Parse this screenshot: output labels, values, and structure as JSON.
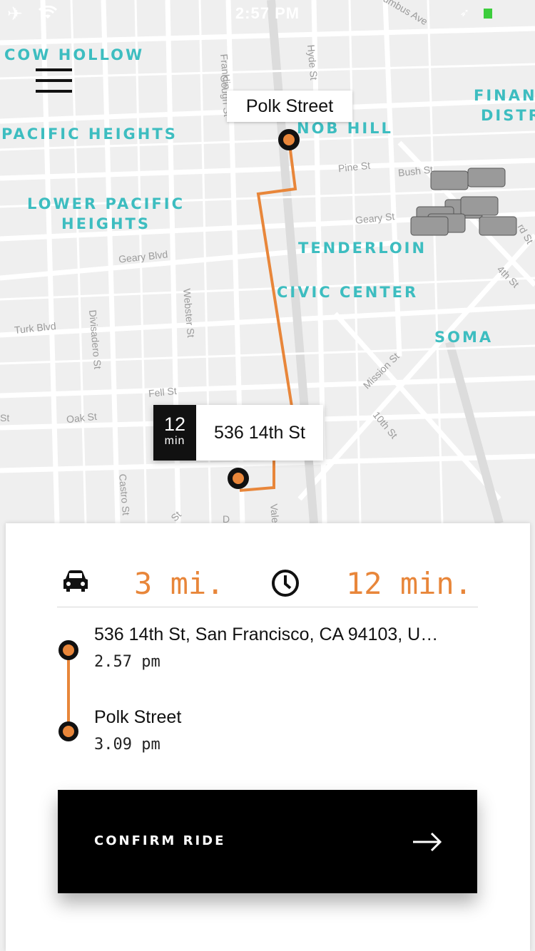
{
  "status_bar": {
    "time": "2:57 PM"
  },
  "map": {
    "districts": [
      "COW HOLLOW",
      "PACIFIC HEIGHTS",
      "LOWER PACIFIC",
      "HEIGHTS",
      "NOB HILL",
      "TENDERLOIN",
      "CIVIC CENTER",
      "SOMA",
      "FINAN",
      "DISTR"
    ],
    "streets": [
      "Franklin",
      "Gough St",
      "Hyde St",
      "Pine St",
      "Bush St",
      "Geary St",
      "Geary Blvd",
      "Webster St",
      "Turk Blvd",
      "Divisadero St",
      "Fell St",
      "Oak St",
      "Mission St",
      "10th St",
      "4th St",
      "Castro St",
      "St",
      "St",
      "Vale",
      "D",
      "rd St",
      "umbus Ave"
    ]
  },
  "pickup_pin": {
    "label": "Polk Street"
  },
  "dropoff_pin": {
    "eta_number": "12",
    "eta_unit": "min",
    "label": "536 14th St"
  },
  "summary": {
    "distance": "3 mi.",
    "duration": "12 min."
  },
  "route": {
    "origin": {
      "address": "536 14th St, San Francisco, CA 94103, U…",
      "time": "2.57 pm"
    },
    "destination": {
      "address": "Polk Street",
      "time": "3.09 pm"
    }
  },
  "confirm_button": {
    "label": "CONFIRM RIDE"
  },
  "colors": {
    "accent": "#e8863a",
    "district_text": "#3dbdc0",
    "button_bg": "#000000"
  }
}
